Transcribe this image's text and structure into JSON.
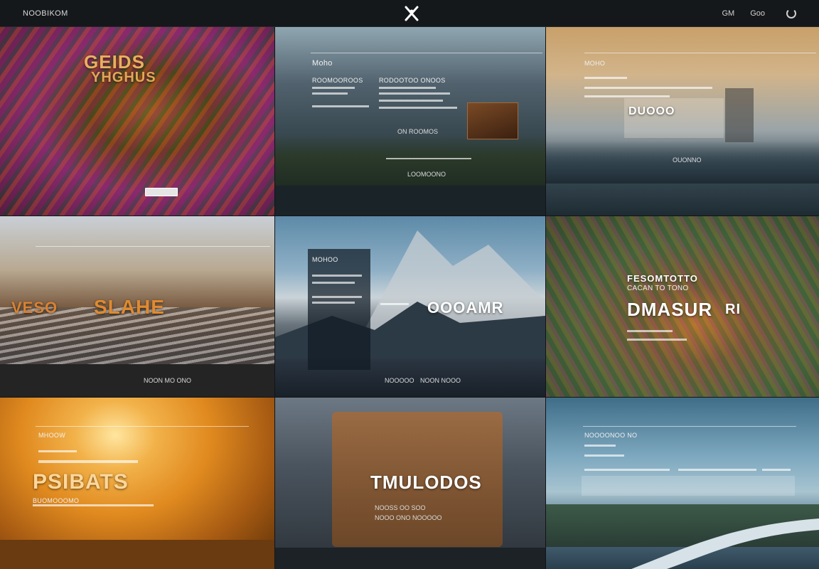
{
  "header": {
    "brand": "NOOBIKOM",
    "nav": [
      "GM",
      "Goo"
    ]
  },
  "colors": {
    "topbar": "#15181b",
    "accent_orange": "#e98a1f",
    "text": "#f0f0f0"
  },
  "icons": {
    "logo": "crossed-x-logo-icon",
    "refresh": "refresh-icon"
  },
  "tiles": [
    {
      "title": "GEIDS",
      "subtitle": "YHGHUS",
      "button": ""
    },
    {
      "title": "Moho",
      "heading_left": "ROOMOOROOS",
      "heading_right": "RODOOTOO ONOOS",
      "caption": "ON ROOMOS",
      "footer": "LOOMOONO"
    },
    {
      "title": "MOHO",
      "big": "DUOOO",
      "caption": "OUONNO"
    },
    {
      "big": "SLAHE",
      "left": "VESO",
      "footer": "NOON MO ONO"
    },
    {
      "title": "MOHOO",
      "big": "OOOAMR",
      "footer_left": "NOOOOO",
      "footer_right": "NOON NOOO"
    },
    {
      "title": "FESOMTOTTO",
      "subtitle": "CACAN TO TONO",
      "big": "DMASUR",
      "big_suffix": "RI"
    },
    {
      "title": "MHOOW",
      "big": "PSIBATS",
      "subtitle": "BUOMOOOMO"
    },
    {
      "big": "TMULODOS",
      "caption_1": "NOOSS OO SOO",
      "caption_2": "NOOO ONO NOOOOO"
    },
    {
      "title": "NOOOONOO NO"
    }
  ]
}
